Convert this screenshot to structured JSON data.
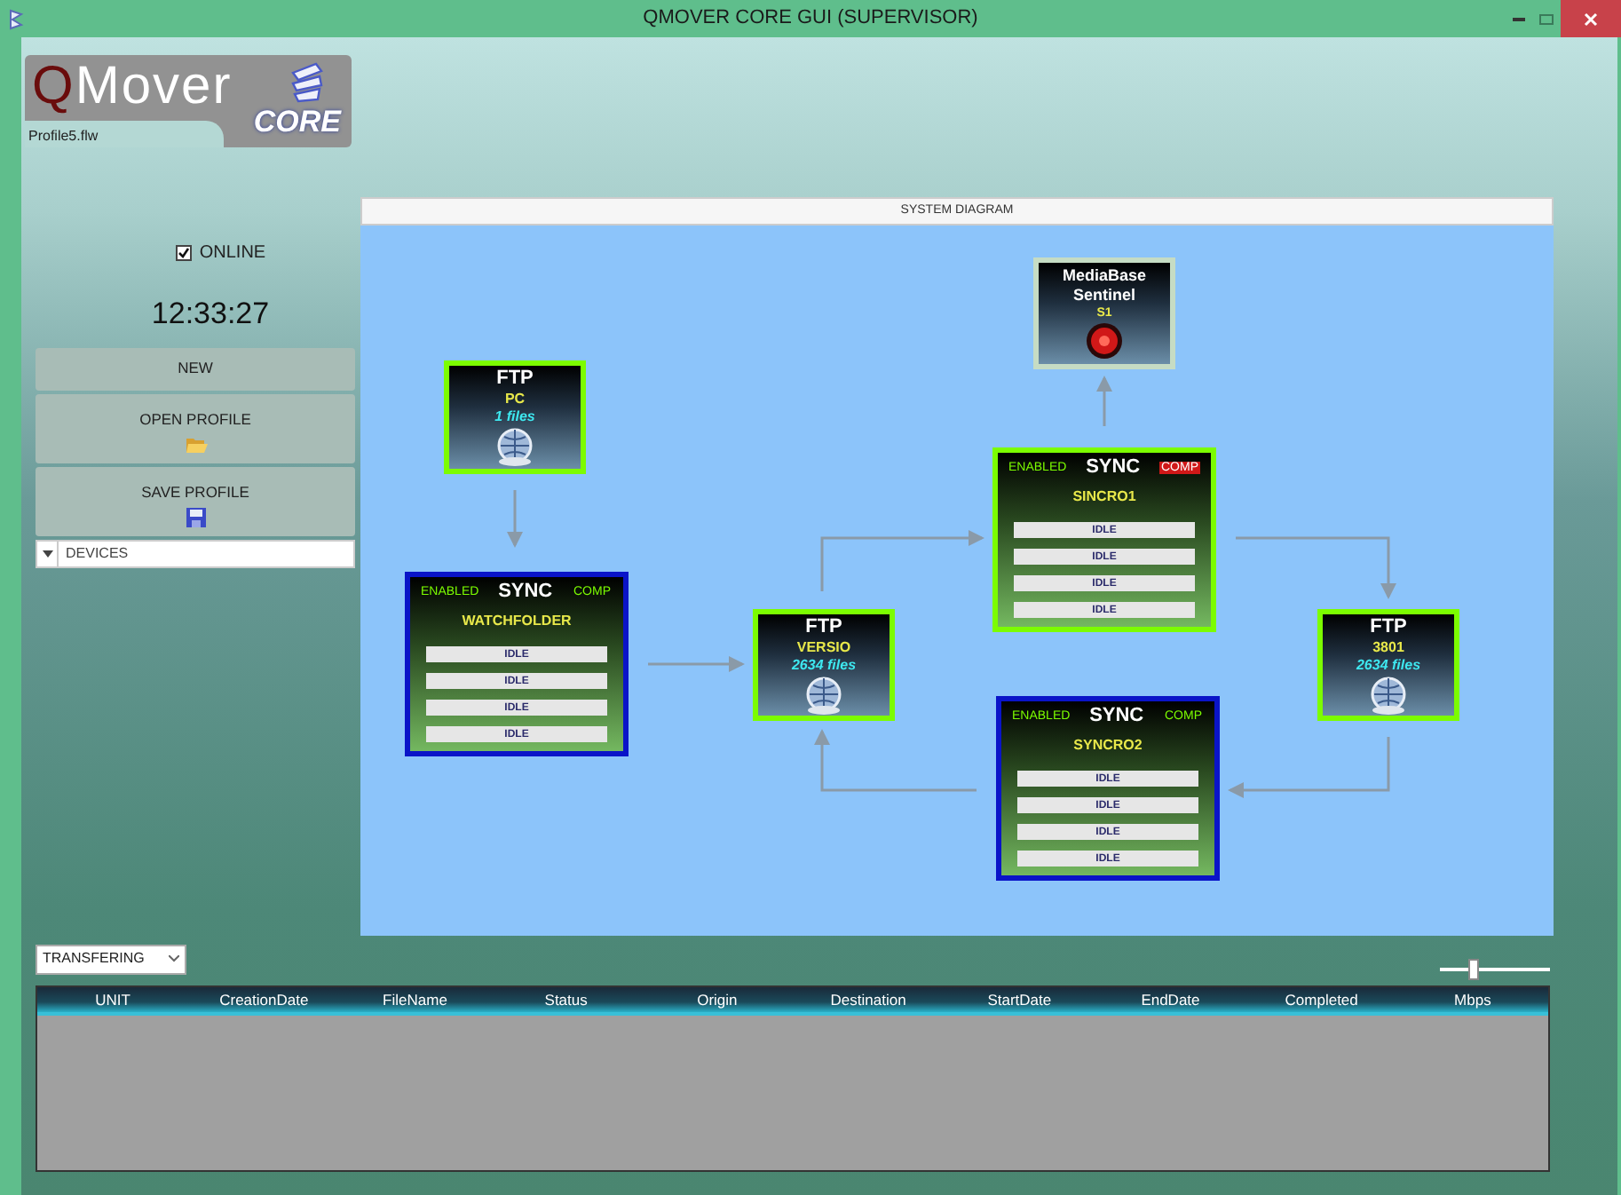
{
  "window": {
    "title": "QMOVER CORE GUI  (SUPERVISOR)"
  },
  "logo": {
    "initial": "Q",
    "rest": "Mover",
    "badge": "CORE"
  },
  "profile_file": "Profile5.flw",
  "online": {
    "label": "ONLINE",
    "checked": true
  },
  "clock": "12:33:27",
  "actions": [
    {
      "label": "NEW",
      "kind": "plain"
    },
    {
      "label": "OPEN PROFILE",
      "kind": "open"
    },
    {
      "label": "SAVE PROFILE",
      "kind": "save"
    }
  ],
  "devices": {
    "label": "DEVICES",
    "expanded": false
  },
  "diagram": {
    "title": "SYSTEM DIAGRAM",
    "nodes": [
      {
        "kind": "ftp",
        "title": "FTP",
        "name": "PC",
        "files": "1 files",
        "color": "#7cfc00"
      },
      {
        "kind": "sync",
        "enabled_label": "ENABLED",
        "title": "SYNC",
        "comp_label": "COMP",
        "comp_alert": false,
        "name": "WATCHFOLDER",
        "slots": [
          "IDLE",
          "IDLE",
          "IDLE",
          "IDLE"
        ],
        "color": "#0a14c8"
      },
      {
        "kind": "ftp",
        "title": "FTP",
        "name": "VERSIO",
        "files": "2634 files",
        "color": "#7cfc00"
      },
      {
        "kind": "sentinel",
        "title": "MediaBase Sentinel",
        "name": "S1",
        "color": "#c6dcc4"
      },
      {
        "kind": "sync",
        "enabled_label": "ENABLED",
        "title": "SYNC",
        "comp_label": "COMP",
        "comp_alert": true,
        "name": "SINCRO1",
        "slots": [
          "IDLE",
          "IDLE",
          "IDLE",
          "IDLE"
        ],
        "color": "#7cfc00"
      },
      {
        "kind": "ftp",
        "title": "FTP",
        "name": "3801",
        "files": "2634 files",
        "color": "#7cfc00"
      },
      {
        "kind": "sync",
        "enabled_label": "ENABLED",
        "title": "SYNC",
        "comp_label": "COMP",
        "comp_alert": false,
        "name": "SYNCRO2",
        "slots": [
          "IDLE",
          "IDLE",
          "IDLE",
          "IDLE"
        ],
        "color": "#0a14c8"
      }
    ]
  },
  "transfer_filter": {
    "value": "TRANSFERING"
  },
  "zoom_slider": {
    "level": 0.3
  },
  "table": {
    "columns": [
      "UNIT",
      "CreationDate",
      "FileName",
      "Status",
      "Origin",
      "Destination",
      "StartDate",
      "EndDate",
      "Completed",
      "Mbps"
    ]
  }
}
